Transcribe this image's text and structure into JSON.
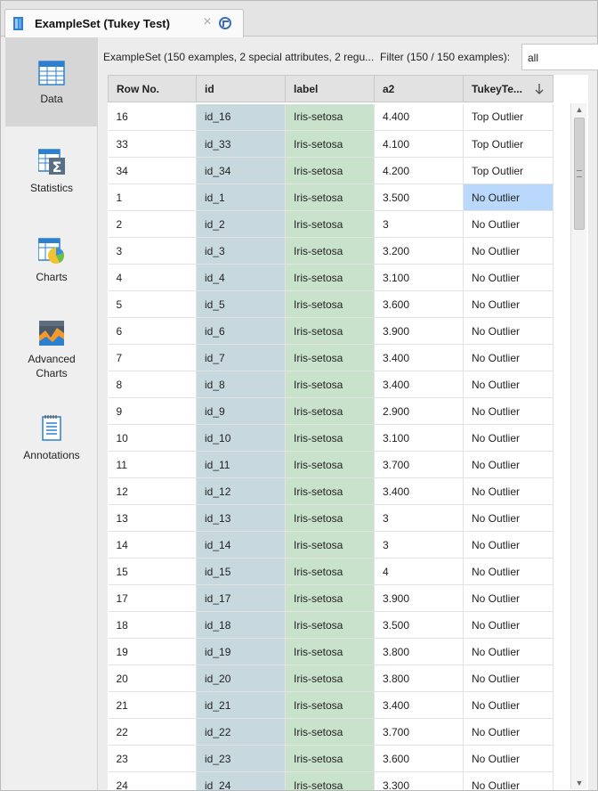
{
  "tab": {
    "title": "ExampleSet (Tukey Test)",
    "close_symbol": "×",
    "icon": "exampleset-icon"
  },
  "nav": {
    "items": [
      {
        "label": "Data",
        "icon": "data-table-icon",
        "active": true
      },
      {
        "label": "Statistics",
        "icon": "statistics-icon"
      },
      {
        "label": "Charts",
        "icon": "charts-icon"
      },
      {
        "label_line1": "Advanced",
        "label_line2": "Charts",
        "icon": "advanced-charts-icon"
      },
      {
        "label": "Annotations",
        "icon": "annotations-icon"
      }
    ]
  },
  "summary": "ExampleSet (150 examples, 2 special attributes, 2 regu...",
  "filter": {
    "label": "Filter (150 / 150 examples):",
    "value": "all"
  },
  "table": {
    "columns": [
      "Row No.",
      "id",
      "label",
      "a2",
      "TukeyTe..."
    ],
    "sort_icon": "sort-descending-icon",
    "rows": [
      [
        "16",
        "id_16",
        "Iris-setosa",
        "4.400",
        "Top Outlier"
      ],
      [
        "33",
        "id_33",
        "Iris-setosa",
        "4.100",
        "Top Outlier"
      ],
      [
        "34",
        "id_34",
        "Iris-setosa",
        "4.200",
        "Top Outlier"
      ],
      [
        "1",
        "id_1",
        "Iris-setosa",
        "3.500",
        "No Outlier"
      ],
      [
        "2",
        "id_2",
        "Iris-setosa",
        "3",
        "No Outlier"
      ],
      [
        "3",
        "id_3",
        "Iris-setosa",
        "3.200",
        "No Outlier"
      ],
      [
        "4",
        "id_4",
        "Iris-setosa",
        "3.100",
        "No Outlier"
      ],
      [
        "5",
        "id_5",
        "Iris-setosa",
        "3.600",
        "No Outlier"
      ],
      [
        "6",
        "id_6",
        "Iris-setosa",
        "3.900",
        "No Outlier"
      ],
      [
        "7",
        "id_7",
        "Iris-setosa",
        "3.400",
        "No Outlier"
      ],
      [
        "8",
        "id_8",
        "Iris-setosa",
        "3.400",
        "No Outlier"
      ],
      [
        "9",
        "id_9",
        "Iris-setosa",
        "2.900",
        "No Outlier"
      ],
      [
        "10",
        "id_10",
        "Iris-setosa",
        "3.100",
        "No Outlier"
      ],
      [
        "11",
        "id_11",
        "Iris-setosa",
        "3.700",
        "No Outlier"
      ],
      [
        "12",
        "id_12",
        "Iris-setosa",
        "3.400",
        "No Outlier"
      ],
      [
        "13",
        "id_13",
        "Iris-setosa",
        "3",
        "No Outlier"
      ],
      [
        "14",
        "id_14",
        "Iris-setosa",
        "3",
        "No Outlier"
      ],
      [
        "15",
        "id_15",
        "Iris-setosa",
        "4",
        "No Outlier"
      ],
      [
        "17",
        "id_17",
        "Iris-setosa",
        "3.900",
        "No Outlier"
      ],
      [
        "18",
        "id_18",
        "Iris-setosa",
        "3.500",
        "No Outlier"
      ],
      [
        "19",
        "id_19",
        "Iris-setosa",
        "3.800",
        "No Outlier"
      ],
      [
        "20",
        "id_20",
        "Iris-setosa",
        "3.800",
        "No Outlier"
      ],
      [
        "21",
        "id_21",
        "Iris-setosa",
        "3.400",
        "No Outlier"
      ],
      [
        "22",
        "id_22",
        "Iris-setosa",
        "3.700",
        "No Outlier"
      ],
      [
        "23",
        "id_23",
        "Iris-setosa",
        "3.600",
        "No Outlier"
      ],
      [
        "24",
        "id_24",
        "Iris-setosa",
        "3.300",
        "No Outlier"
      ]
    ],
    "selected_row": 3,
    "selected_col": 4
  },
  "colors": {
    "id_column": "#c8d8df",
    "label_column": "#c8e2cc",
    "selection": "#b9d8fb",
    "accent": "#3a6fb5"
  }
}
